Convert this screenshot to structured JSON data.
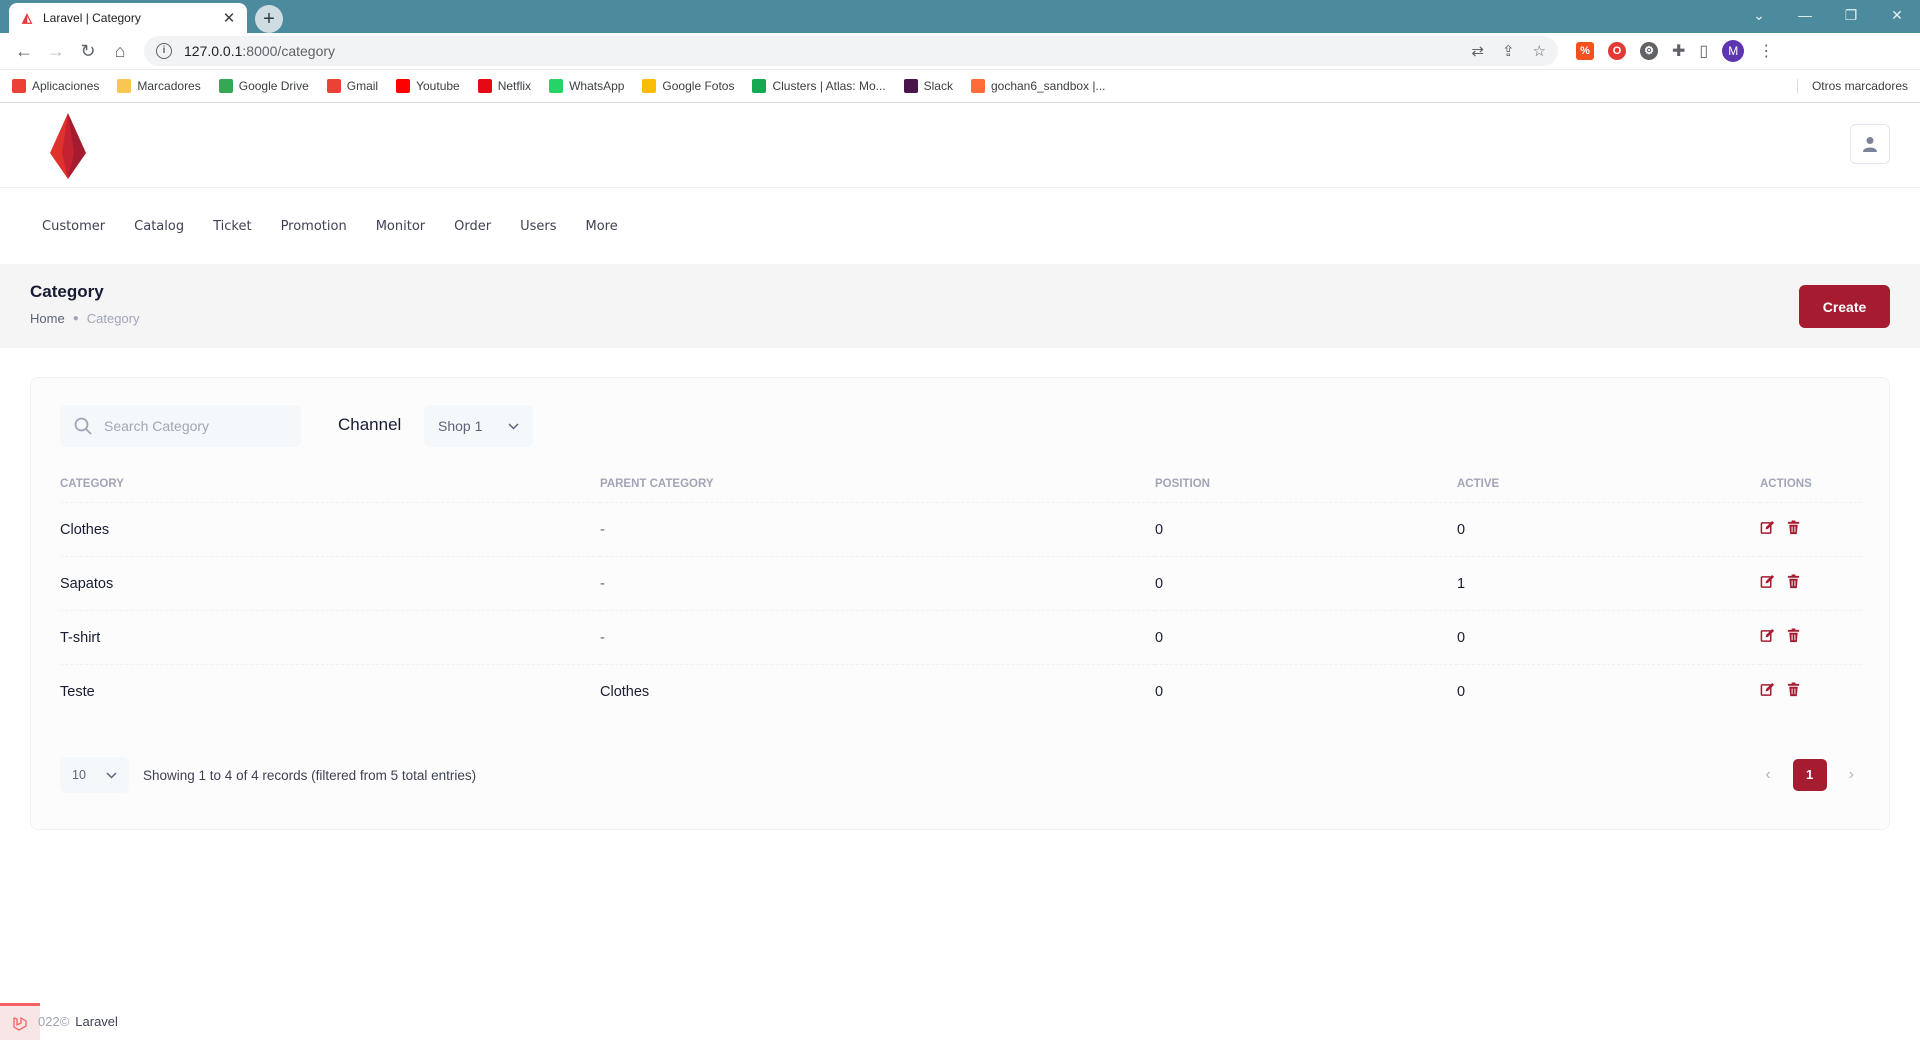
{
  "browser": {
    "tab_title": "Laravel | Category",
    "url_host": "127.0.0.1",
    "url_path": ":8000/category",
    "profile_initial": "M",
    "bookmarks": [
      {
        "label": "Aplicaciones",
        "icon": "apps-grid-icon",
        "color": "#ea4335"
      },
      {
        "label": "Marcadores",
        "icon": "folder-icon",
        "color": "#f9c74f"
      },
      {
        "label": "Google Drive",
        "icon": "google-drive-icon",
        "color": "#34a853"
      },
      {
        "label": "Gmail",
        "icon": "gmail-icon",
        "color": "#ea4335"
      },
      {
        "label": "Youtube",
        "icon": "youtube-icon",
        "color": "#ff0000"
      },
      {
        "label": "Netflix",
        "icon": "netflix-icon",
        "color": "#e50914"
      },
      {
        "label": "WhatsApp",
        "icon": "whatsapp-icon",
        "color": "#25d366"
      },
      {
        "label": "Google Fotos",
        "icon": "google-photos-icon",
        "color": "#fbbc04"
      },
      {
        "label": "Clusters | Atlas: Mo...",
        "icon": "mongodb-icon",
        "color": "#13aa52"
      },
      {
        "label": "Slack",
        "icon": "slack-icon",
        "color": "#4a154b"
      },
      {
        "label": "gochan6_sandbox |...",
        "icon": "postman-icon",
        "color": "#ff6c37"
      }
    ],
    "other_bookmarks": "Otros marcadores"
  },
  "nav": {
    "items": [
      "Customer",
      "Catalog",
      "Ticket",
      "Promotion",
      "Monitor",
      "Order",
      "Users",
      "More"
    ]
  },
  "toolbar": {
    "title": "Category",
    "breadcrumb_home": "Home",
    "breadcrumb_current": "Category",
    "create_label": "Create"
  },
  "filters": {
    "search_placeholder": "Search Category",
    "channel_label": "Channel",
    "channel_value": "Shop 1"
  },
  "table": {
    "headers": [
      "CATEGORY",
      "PARENT CATEGORY",
      "POSITION",
      "ACTIVE",
      "ACTIONS"
    ],
    "rows": [
      {
        "category": "Clothes",
        "parent": "-",
        "position": "0",
        "active": "0"
      },
      {
        "category": "Sapatos",
        "parent": "-",
        "position": "0",
        "active": "1"
      },
      {
        "category": "T-shirt",
        "parent": "-",
        "position": "0",
        "active": "0"
      },
      {
        "category": "Teste",
        "parent": "Clothes",
        "position": "0",
        "active": "0"
      }
    ]
  },
  "pagination": {
    "page_size": "10",
    "records_info": "Showing 1 to 4 of 4 records (filtered from 5 total entries)",
    "current_page": "1"
  },
  "footer": {
    "year": "022©",
    "brand": "Laravel"
  },
  "colors": {
    "accent": "#a51c30",
    "toolbar_bg": "#f5f5f6",
    "browser_tab_strip": "#4c8a9e"
  }
}
